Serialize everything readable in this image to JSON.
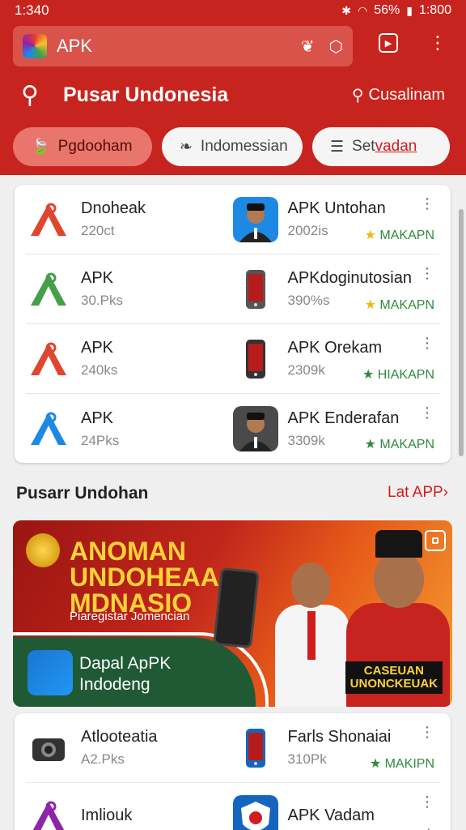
{
  "status": {
    "time": "1:340",
    "battery": "56%",
    "clock": "1:800"
  },
  "browser": {
    "url": "APK"
  },
  "header": {
    "title": "Pusar Undonesia",
    "search_label": "Cusalinam"
  },
  "chips": [
    {
      "label": "Pgdooham"
    },
    {
      "label": "Indomessian"
    },
    {
      "label_a": "Set",
      "label_b": "vadan"
    }
  ],
  "apps_top": [
    [
      {
        "name": "Dnoheak",
        "size": "220ct",
        "icon": "triangle-logo-icon",
        "icon_color": "#e0452f"
      },
      {
        "name": "APK Untohan",
        "size": "2002is",
        "icon": "person-icon",
        "icon_color": "#1e88e5",
        "badge": "MAKAPN",
        "star": "gold"
      }
    ],
    [
      {
        "name": "APK",
        "size": "30.Pks",
        "icon": "triangle-logo-icon",
        "icon_color": "#43a047"
      },
      {
        "name": "APKdoginutosian",
        "size": "390%s",
        "icon": "phone-icon",
        "icon_color": "#555555",
        "badge": "MAKAPN",
        "star": "gold"
      }
    ],
    [
      {
        "name": "APK",
        "size": "240ks",
        "icon": "triangle-logo-icon",
        "icon_color": "#e0452f"
      },
      {
        "name": "APK Orekam",
        "size": "2309k",
        "icon": "phone-icon",
        "icon_color": "#333333",
        "badge": "HIAKAPN",
        "star": "green"
      }
    ],
    [
      {
        "name": "APK",
        "size": "24Pks",
        "icon": "triangle-logo-icon",
        "icon_color": "#1e88e5"
      },
      {
        "name": "APK Enderafan",
        "size": "3309k",
        "icon": "person-icon",
        "icon_color": "#4a4a4a",
        "badge": "MAKAPN",
        "star": "green"
      }
    ]
  ],
  "section": {
    "title": "Pusarr Undohan",
    "link": "Lat APP"
  },
  "banner": {
    "title": "ANOMAN\nUNDOHEAA\nMDNASIO",
    "subtitle": "Piaregistar Jomencian",
    "app_text": "Dapal ApPK\nIndodeng",
    "tag": "CASEUAN\nUNONCKEUAK"
  },
  "apps_bottom": [
    [
      {
        "name": "Atlooteatia",
        "size": "A2.Pks",
        "icon": "camera-icon",
        "icon_color": "#333333"
      },
      {
        "name": "Farls Shonaiai",
        "size": "310Pk",
        "icon": "phone-icon",
        "icon_color": "#1565c0",
        "badge": "MAKIPN",
        "star": "green"
      }
    ],
    [
      {
        "name": "Imliouk",
        "size": "",
        "icon": "triangle-logo-icon",
        "icon_color": "#8e24aa"
      },
      {
        "name": "APK Vadam",
        "size": "",
        "icon": "shield-icon",
        "icon_color": "#1565c0",
        "badge": "",
        "star": "green"
      }
    ]
  ]
}
